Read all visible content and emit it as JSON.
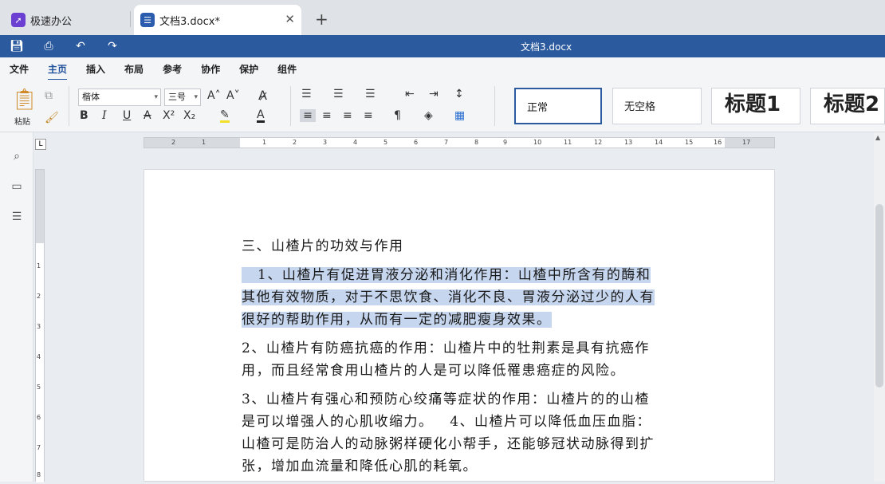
{
  "tabs": [
    {
      "label": "极速办公"
    },
    {
      "label": "文档3.docx*"
    }
  ],
  "new_tab": "+",
  "titlebar": {
    "title": "文档3.docx"
  },
  "menu": [
    "文件",
    "主页",
    "插入",
    "布局",
    "参考",
    "协作",
    "保护",
    "组件"
  ],
  "ribbon": {
    "paste_label": "粘贴",
    "font_name": "楷体",
    "font_size": "三号",
    "styles": [
      "正常",
      "无空格",
      "标题1",
      "标题2"
    ]
  },
  "ruler": {
    "h_numbers": [
      "2",
      "1",
      "1",
      "2",
      "3",
      "4",
      "5",
      "6",
      "7",
      "8",
      "9",
      "10",
      "11",
      "12",
      "13",
      "14",
      "15",
      "16",
      "17"
    ],
    "v_numbers": [
      "1",
      "2",
      "3",
      "4",
      "5",
      "6",
      "7",
      "8"
    ]
  },
  "document": {
    "heading": "三、山楂片的功效与作用",
    "p1_lines": [
      "1、山楂片有促进胃液分泌和消化作用：山楂中所含有的酶和",
      "其他有效物质，对于不思饮食、消化不良、胃液分泌过少的人有",
      "很好的帮助作用，从而有一定的减肥瘦身效果。"
    ],
    "p2_lines": [
      "2、山楂片有防癌抗癌的作用：山楂片中的牡荆素是具有抗癌作",
      "用，而且经常食用山楂片的人是可以降低罹患癌症的风险。"
    ],
    "p3_lines": [
      "3、山楂片有强心和预防心绞痛等症状的作用：山楂片的的山楂",
      "是可以增强人的心肌收缩力。   4、山楂片可以降低血压血脂：",
      "山楂可是防治人的动脉粥样硬化小帮手，还能够冠状动脉得到扩",
      "张，增加血流量和降低心肌的耗氧。"
    ]
  },
  "colors": {
    "accent": "#2b5a9e",
    "highlight": "#c6d6ef"
  }
}
